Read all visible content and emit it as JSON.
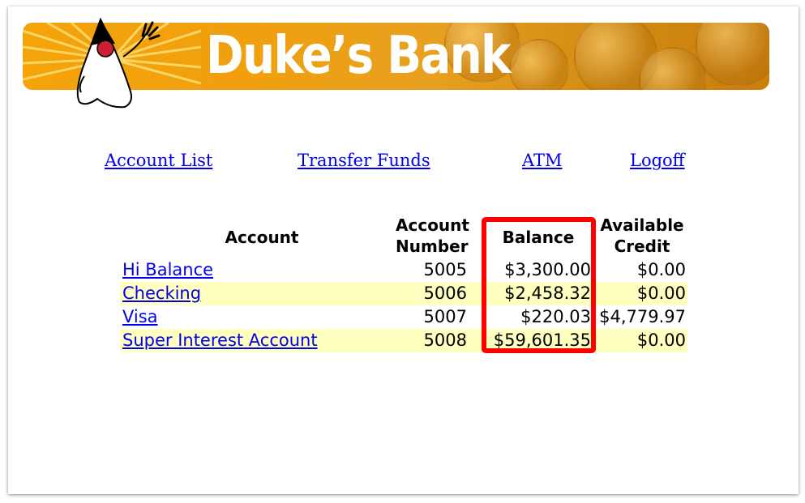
{
  "banner": {
    "title": "Duke’s Bank",
    "logo": "duke-mascot"
  },
  "nav": {
    "account_list": "Account List",
    "transfer_funds": "Transfer Funds",
    "atm": "ATM",
    "logoff": "Logoff"
  },
  "table": {
    "headers": {
      "account": "Account",
      "account_number_1": "Account",
      "account_number_2": "Number",
      "balance": "Balance",
      "available_credit_1": "Available",
      "available_credit_2": "Credit"
    },
    "rows": [
      {
        "account": "Hi Balance",
        "number": "5005",
        "balance": "$3,300.00",
        "credit": "$0.00"
      },
      {
        "account": "Checking",
        "number": "5006",
        "balance": "$2,458.32",
        "credit": "$0.00"
      },
      {
        "account": "Visa",
        "number": "5007",
        "balance": "$220.03",
        "credit": "$4,779.97"
      },
      {
        "account": "Super Interest Account",
        "number": "5008",
        "balance": "$59,601.35",
        "credit": "$0.00"
      }
    ]
  },
  "colors": {
    "link": "#0000ee",
    "row_alt": "#ffffc0",
    "highlight": "#ff0000",
    "banner": "#f0a00e"
  }
}
